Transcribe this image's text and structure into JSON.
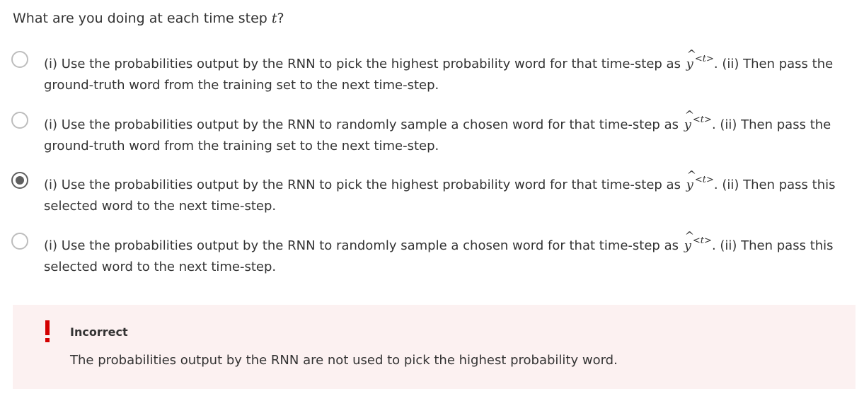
{
  "question": {
    "prefix": "What are you doing at each time step ",
    "variable": "t",
    "suffix": "?"
  },
  "math": {
    "y_hat_symbol": "y",
    "superscript_left": "<",
    "superscript_var": "t",
    "superscript_right": ">"
  },
  "options": [
    {
      "part1": "(i) Use the probabilities output by the RNN to pick the highest probability word for that time-step as ",
      "part2": ". (ii) Then pass the ground-truth word from the training set to the next time-step.",
      "selected": false
    },
    {
      "part1": "(i) Use the probabilities output by the RNN to randomly sample a chosen word for that time-step as ",
      "part2": ". (ii) Then pass the ground-truth word from the training set to the next time-step.",
      "selected": false
    },
    {
      "part1": "(i) Use the probabilities output by the RNN to pick the highest probability word for that time-step as ",
      "part2": ". (ii) Then pass this selected word to the next time-step.",
      "selected": true
    },
    {
      "part1": "(i) Use the probabilities output by the RNN to randomly sample a chosen word for that time-step as ",
      "part2": ". (ii) Then pass this selected word to the next time-step.",
      "selected": false
    }
  ],
  "feedback": {
    "status": "Incorrect",
    "message": "The probabilities output by the RNN are not used to pick the highest probability word.",
    "icon": "exclamation-icon",
    "background_color": "#fcf1f1",
    "icon_color": "#d30000"
  },
  "colors": {
    "text": "#333333",
    "radio_border": "#bdbdbd",
    "radio_selected": "#5f5f5f"
  }
}
